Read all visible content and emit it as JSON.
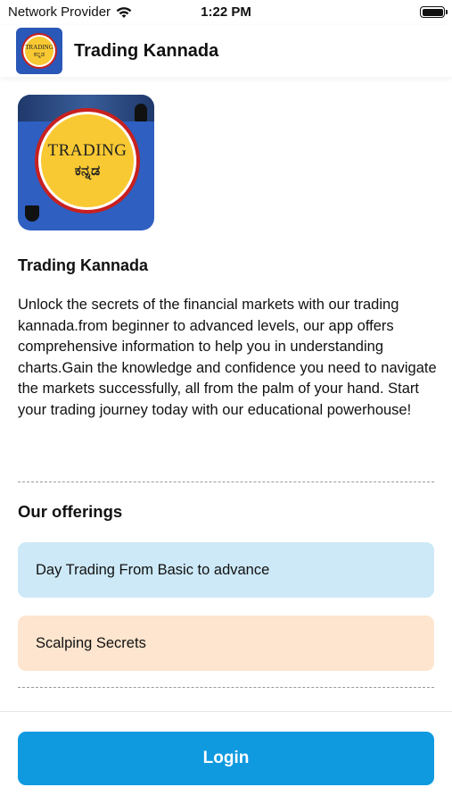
{
  "status_bar": {
    "carrier": "Network Provider",
    "wifi_icon": "wifi-icon",
    "time": "1:22 PM",
    "battery_icon": "battery-icon"
  },
  "header": {
    "logo_text_line1": "TRADING",
    "logo_text_line2": "ಕನ್ನಡ",
    "title": "Trading Kannada"
  },
  "course": {
    "image_text_line1": "TRADING",
    "image_text_line2": "ಕನ್ನಡ",
    "title": "Trading Kannada",
    "description": "Unlock the secrets of the financial markets with our trading kannada.from beginner to advanced levels, our app offers comprehensive information to help you in understanding charts.Gain the knowledge and confidence you need to navigate the markets successfully, all from the palm of your hand. Start your trading journey today with our educational powerhouse!"
  },
  "offerings": {
    "title": "Our offerings",
    "items": [
      {
        "label": "Day Trading From Basic to advance",
        "color": "#cde9f7"
      },
      {
        "label": "Scalping Secrets",
        "color": "#fde5cf"
      }
    ]
  },
  "footer": {
    "login_label": "Login",
    "accent_color": "#0f9ae0"
  }
}
